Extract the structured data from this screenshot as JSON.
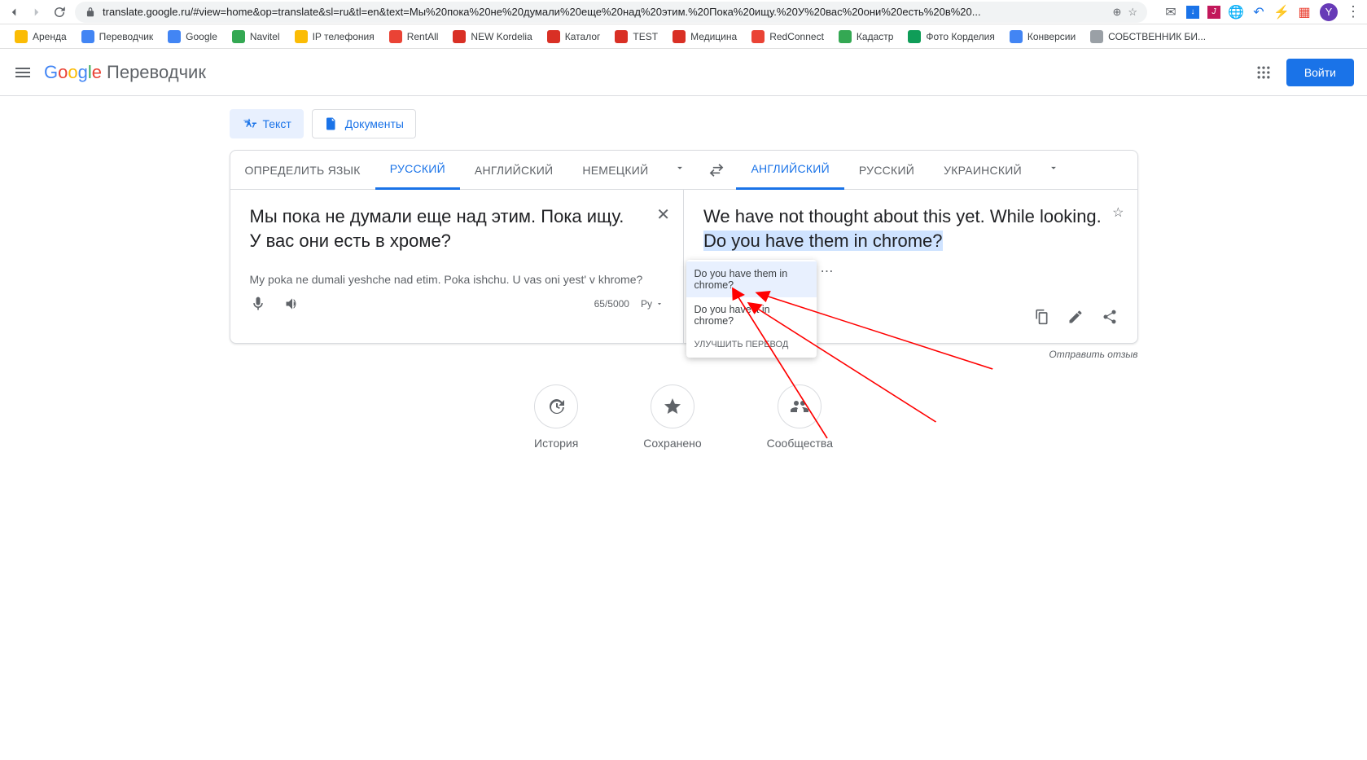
{
  "browser": {
    "url": "translate.google.ru/#view=home&op=translate&sl=ru&tl=en&text=Мы%20пока%20не%20думали%20еще%20над%20этим.%20Пока%20ищу.%20У%20вас%20они%20есть%20в%20...",
    "avatar_initial": "Y"
  },
  "bookmarks": [
    {
      "label": "Аренда",
      "color": "#fbbc05"
    },
    {
      "label": "Переводчик",
      "color": "#4285f4"
    },
    {
      "label": "Google",
      "color": "#4285f4"
    },
    {
      "label": "Navitel",
      "color": "#34a853"
    },
    {
      "label": "IP телефония",
      "color": "#fbbc05"
    },
    {
      "label": "RentAll",
      "color": "#ea4335"
    },
    {
      "label": "NEW Kordelia",
      "color": "#d93025"
    },
    {
      "label": "Каталог",
      "color": "#d93025"
    },
    {
      "label": "TEST",
      "color": "#d93025"
    },
    {
      "label": "Медицина",
      "color": "#d93025"
    },
    {
      "label": "RedConnect",
      "color": "#ea4335"
    },
    {
      "label": "Кадастр",
      "color": "#34a853"
    },
    {
      "label": "Фото Корделия",
      "color": "#0f9d58"
    },
    {
      "label": "Конверсии",
      "color": "#4285f4"
    },
    {
      "label": "СОБСТВЕННИК БИ...",
      "color": "#9aa0a6"
    }
  ],
  "header": {
    "product": "Переводчик",
    "signin": "Войти"
  },
  "input_tabs": {
    "text": "Текст",
    "documents": "Документы"
  },
  "source_langs": {
    "detect": "ОПРЕДЕЛИТЬ ЯЗЫК",
    "ru": "РУССКИЙ",
    "en": "АНГЛИЙСКИЙ",
    "de": "НЕМЕЦКИЙ"
  },
  "target_langs": {
    "en": "АНГЛИЙСКИЙ",
    "ru": "РУССКИЙ",
    "uk": "УКРАИНСКИЙ"
  },
  "source_text": "Мы пока не думали еще над этим. Пока ищу. У вас они есть в хроме?",
  "transliteration": "My poka ne dumali yeshche nad etim. Poka ishchu. U vas oni yest' v khrome?",
  "counter": "65/5000",
  "ime_label": "Ру",
  "target_text_plain": "We have not thought about this yet. While looking. ",
  "target_text_hl": "Do you have them in chrome?",
  "suggestions": {
    "opt1": "Do you have them in chrome?",
    "opt2": "Do you have it in chrome?",
    "improve": "УЛУЧШИТЬ ПЕРЕВОД"
  },
  "quick": {
    "history": "История",
    "saved": "Сохранено",
    "community": "Сообщества"
  },
  "feedback": "Отправить отзыв"
}
